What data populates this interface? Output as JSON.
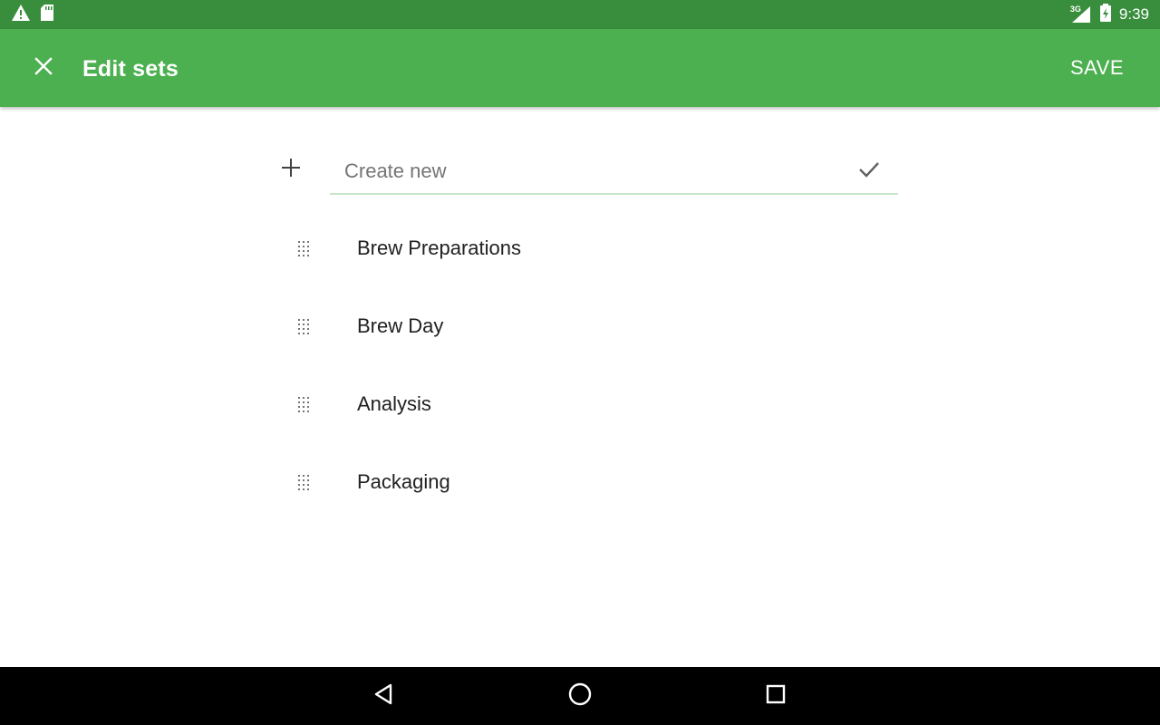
{
  "status_bar": {
    "time": "9:39",
    "network": "3G",
    "icons": [
      "warning-icon",
      "sd-card-icon",
      "signal-icon",
      "battery-icon"
    ]
  },
  "app_bar": {
    "title": "Edit sets",
    "save_label": "SAVE",
    "close_icon": "close-icon",
    "color": "#4caf50",
    "status_color": "#388e3c"
  },
  "create": {
    "placeholder": "Create new",
    "value": "",
    "add_icon": "plus-icon",
    "confirm_icon": "check-icon",
    "underline_color": "#c8e6c9"
  },
  "sets": [
    {
      "label": "Brew Preparations"
    },
    {
      "label": "Brew Day"
    },
    {
      "label": "Analysis"
    },
    {
      "label": "Packaging"
    }
  ],
  "nav_bar": {
    "icons": [
      "back-icon",
      "home-icon",
      "recents-icon"
    ]
  }
}
